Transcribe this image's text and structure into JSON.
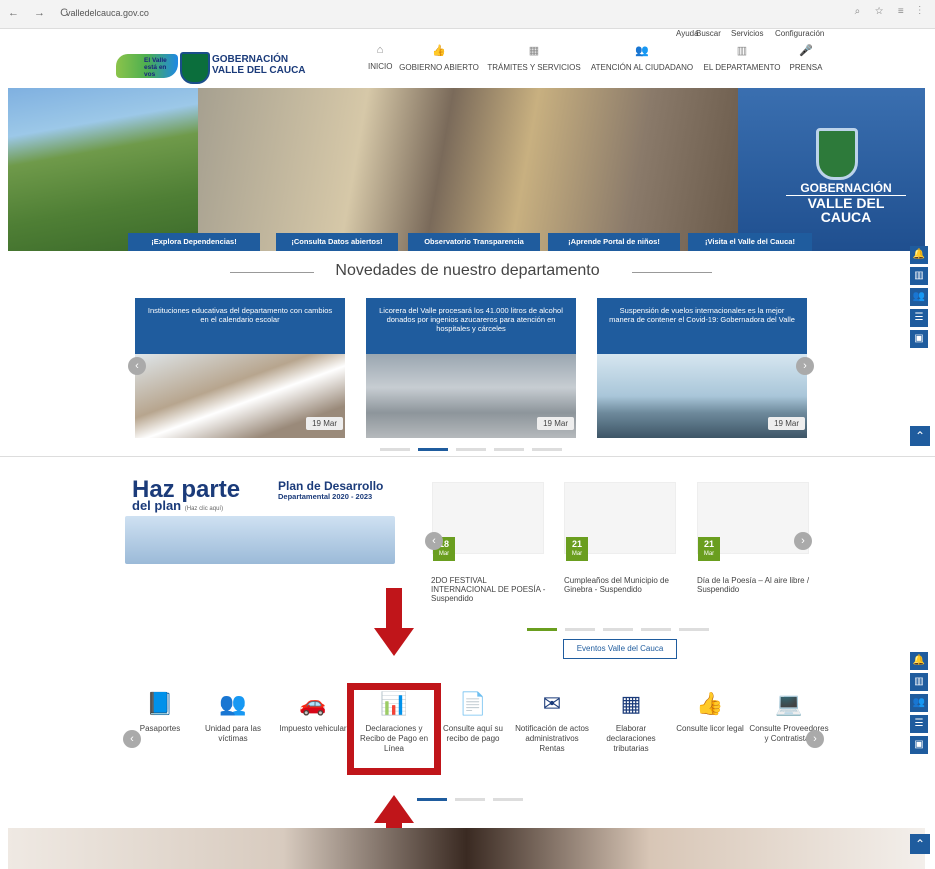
{
  "browser": {
    "url": "valledelcauca.gov.co",
    "nav": "← → C",
    "right": "⌕ ☆ ≡ ⋮"
  },
  "toplinks": [
    "Ayuda",
    "Buscar",
    "Servicios",
    "Configuración"
  ],
  "header": {
    "logo_text": "El Valle está en vos",
    "title_line1": "GOBERNACIÓN",
    "title_line2": "VALLE DEL CAUCA",
    "menu": [
      "INICIO",
      "GOBIERNO ABIERTO",
      "TRÁMITES Y SERVICIOS",
      "ATENCIÓN AL CIUDADANO",
      "EL DEPARTAMENTO",
      "PRENSA"
    ]
  },
  "hero": {
    "gov_line1": "GOBERNACIÓN",
    "gov_line2": "VALLE DEL CAUCA",
    "tabs": [
      "¡Explora Dependencias!",
      "¡Consulta Datos abiertos!",
      "Observatorio Transparencia",
      "¡Aprende Portal de niños!",
      "¡Visita el Valle del Cauca!"
    ]
  },
  "news": {
    "section_title": "Novedades de nuestro departamento",
    "cards": [
      {
        "caption": "Instituciones educativas del departamento con cambios en el calendario escolar",
        "date": "19 Mar"
      },
      {
        "caption": "Licorera del Valle procesará los 41.000 litros de alcohol donados por ingenios azucareros para atención en hospitales y cárceles",
        "date": "19 Mar"
      },
      {
        "caption": "Suspensión de vuelos internacionales es la mejor manera de contener el Covid-19: Gobernadora del Valle",
        "date": "19 Mar"
      }
    ]
  },
  "plan": {
    "haz": "Haz parte",
    "del": "del plan",
    "del_small": "(Haz clic aquí)",
    "pd_title": "Plan de Desarrollo",
    "pd_sub": "Departamental 2020 - 2023"
  },
  "events": {
    "items": [
      {
        "day": "18",
        "month": "Mar",
        "text": "2DO FESTIVAL INTERNACIONAL DE POESÍA - Suspendido"
      },
      {
        "day": "21",
        "month": "Mar",
        "text": "Cumpleaños del Municipio de Ginebra - Suspendido"
      },
      {
        "day": "21",
        "month": "Mar",
        "text": "Día de la Poesía – Al aire libre / Suspendido"
      }
    ],
    "button": "Eventos Valle del Cauca"
  },
  "services": [
    {
      "label": "Pasaportes",
      "icon": "book-icon"
    },
    {
      "label": "Unidad para las víctimas",
      "icon": "group-icon"
    },
    {
      "label": "Impuesto vehicular",
      "icon": "car-icon"
    },
    {
      "label": "Declaraciones y Recibo de Pago en Línea",
      "icon": "bar-chart-icon"
    },
    {
      "label": "Consulte aquí su recibo de pago",
      "icon": "document-icon"
    },
    {
      "label": "Notificación de actos administrativos Rentas",
      "icon": "envelope-icon"
    },
    {
      "label": "Elaborar declaraciones tributarias",
      "icon": "calculator-icon"
    },
    {
      "label": "Consulte licor legal",
      "icon": "thumbs-up-icon"
    },
    {
      "label": "Consulte Proveedores y Contratistas",
      "icon": "laptop-icon"
    }
  ],
  "colors": {
    "primary": "#1f5c9e",
    "highlight": "#c0151a",
    "event_green": "#6a9e1f"
  }
}
